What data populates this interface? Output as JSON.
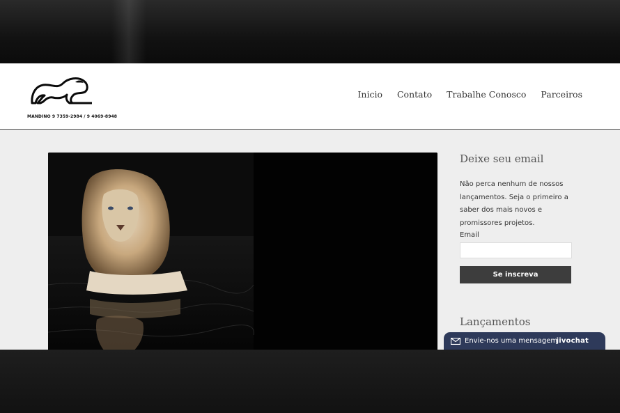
{
  "logo": {
    "caption": "MANDINO 9 7359-2984 / 9 4069-8948"
  },
  "nav": {
    "items": [
      {
        "label": "Inicio"
      },
      {
        "label": "Contato"
      },
      {
        "label": "Trabalhe Conosco"
      },
      {
        "label": "Parceiros"
      }
    ]
  },
  "sidebar": {
    "email_title": "Deixe seu email",
    "email_text": "Não perca nenhum de nossos lançamentos. Seja o primeiro a saber dos mais novos e promissores projetos.",
    "email_label": "Email",
    "subscribe_label": "Se inscreva",
    "launches_title": "Lançamentos"
  },
  "chat": {
    "message": "Envie-nos uma mensagem",
    "brand": "jivochat"
  },
  "colors": {
    "header_bg": "#ffffff",
    "content_bg": "#eeeeee",
    "button_bg": "#3d3d3d",
    "chat_bg": "#2e3a5a"
  },
  "icons": {
    "logo": "panther-logo-icon",
    "chat": "envelope-icon"
  }
}
